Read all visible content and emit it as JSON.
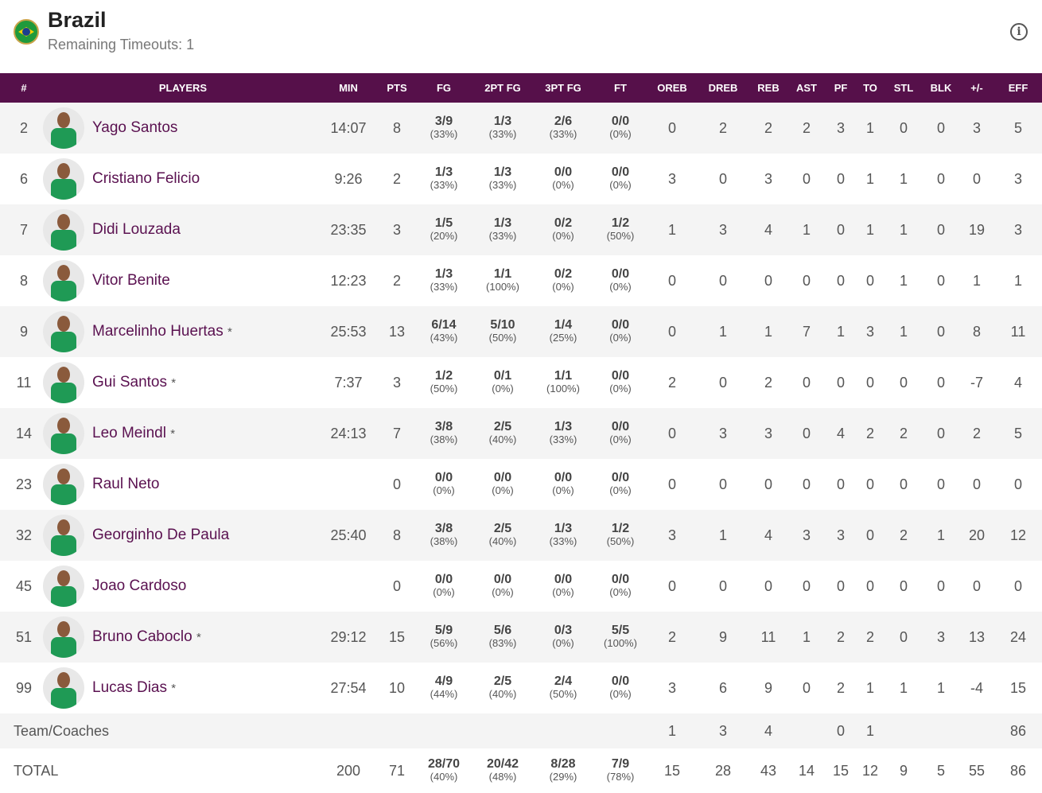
{
  "header": {
    "team": "Brazil",
    "timeouts": "Remaining Timeouts: 1",
    "flag_icon": "brazil-flag-icon",
    "info_icon": "info-icon"
  },
  "columns": [
    "#",
    "PLAYERS",
    "MIN",
    "PTS",
    "FG",
    "2PT FG",
    "3PT FG",
    "FT",
    "OREB",
    "DREB",
    "REB",
    "AST",
    "PF",
    "TO",
    "STL",
    "BLK",
    "+/-",
    "EFF"
  ],
  "players": [
    {
      "num": "2",
      "name": "Yago Santos",
      "star": "",
      "min": "14:07",
      "pts": "8",
      "fg": [
        "3/9",
        "(33%)"
      ],
      "p2": [
        "1/3",
        "(33%)"
      ],
      "p3": [
        "2/6",
        "(33%)"
      ],
      "ft": [
        "0/0",
        "(0%)"
      ],
      "s": [
        "0",
        "2",
        "2",
        "2",
        "3",
        "1",
        "0",
        "0",
        "3",
        "5"
      ]
    },
    {
      "num": "6",
      "name": "Cristiano Felicio",
      "star": "",
      "min": "9:26",
      "pts": "2",
      "fg": [
        "1/3",
        "(33%)"
      ],
      "p2": [
        "1/3",
        "(33%)"
      ],
      "p3": [
        "0/0",
        "(0%)"
      ],
      "ft": [
        "0/0",
        "(0%)"
      ],
      "s": [
        "3",
        "0",
        "3",
        "0",
        "0",
        "1",
        "1",
        "0",
        "0",
        "3"
      ]
    },
    {
      "num": "7",
      "name": "Didi Louzada",
      "star": "",
      "min": "23:35",
      "pts": "3",
      "fg": [
        "1/5",
        "(20%)"
      ],
      "p2": [
        "1/3",
        "(33%)"
      ],
      "p3": [
        "0/2",
        "(0%)"
      ],
      "ft": [
        "1/2",
        "(50%)"
      ],
      "s": [
        "1",
        "3",
        "4",
        "1",
        "0",
        "1",
        "1",
        "0",
        "19",
        "3"
      ]
    },
    {
      "num": "8",
      "name": "Vitor Benite",
      "star": "",
      "min": "12:23",
      "pts": "2",
      "fg": [
        "1/3",
        "(33%)"
      ],
      "p2": [
        "1/1",
        "(100%)"
      ],
      "p3": [
        "0/2",
        "(0%)"
      ],
      "ft": [
        "0/0",
        "(0%)"
      ],
      "s": [
        "0",
        "0",
        "0",
        "0",
        "0",
        "0",
        "1",
        "0",
        "1",
        "1"
      ]
    },
    {
      "num": "9",
      "name": "Marcelinho Huertas",
      "star": "*",
      "min": "25:53",
      "pts": "13",
      "fg": [
        "6/14",
        "(43%)"
      ],
      "p2": [
        "5/10",
        "(50%)"
      ],
      "p3": [
        "1/4",
        "(25%)"
      ],
      "ft": [
        "0/0",
        "(0%)"
      ],
      "s": [
        "0",
        "1",
        "1",
        "7",
        "1",
        "3",
        "1",
        "0",
        "8",
        "11"
      ]
    },
    {
      "num": "11",
      "name": "Gui Santos",
      "star": "*",
      "min": "7:37",
      "pts": "3",
      "fg": [
        "1/2",
        "(50%)"
      ],
      "p2": [
        "0/1",
        "(0%)"
      ],
      "p3": [
        "1/1",
        "(100%)"
      ],
      "ft": [
        "0/0",
        "(0%)"
      ],
      "s": [
        "2",
        "0",
        "2",
        "0",
        "0",
        "0",
        "0",
        "0",
        "-7",
        "4"
      ]
    },
    {
      "num": "14",
      "name": "Leo Meindl",
      "star": "*",
      "min": "24:13",
      "pts": "7",
      "fg": [
        "3/8",
        "(38%)"
      ],
      "p2": [
        "2/5",
        "(40%)"
      ],
      "p3": [
        "1/3",
        "(33%)"
      ],
      "ft": [
        "0/0",
        "(0%)"
      ],
      "s": [
        "0",
        "3",
        "3",
        "0",
        "4",
        "2",
        "2",
        "0",
        "2",
        "5"
      ]
    },
    {
      "num": "23",
      "name": "Raul Neto",
      "star": "",
      "min": "",
      "pts": "0",
      "fg": [
        "0/0",
        "(0%)"
      ],
      "p2": [
        "0/0",
        "(0%)"
      ],
      "p3": [
        "0/0",
        "(0%)"
      ],
      "ft": [
        "0/0",
        "(0%)"
      ],
      "s": [
        "0",
        "0",
        "0",
        "0",
        "0",
        "0",
        "0",
        "0",
        "0",
        "0"
      ]
    },
    {
      "num": "32",
      "name": "Georginho De Paula",
      "star": "",
      "min": "25:40",
      "pts": "8",
      "fg": [
        "3/8",
        "(38%)"
      ],
      "p2": [
        "2/5",
        "(40%)"
      ],
      "p3": [
        "1/3",
        "(33%)"
      ],
      "ft": [
        "1/2",
        "(50%)"
      ],
      "s": [
        "3",
        "1",
        "4",
        "3",
        "3",
        "0",
        "2",
        "1",
        "20",
        "12"
      ]
    },
    {
      "num": "45",
      "name": "Joao Cardoso",
      "star": "",
      "min": "",
      "pts": "0",
      "fg": [
        "0/0",
        "(0%)"
      ],
      "p2": [
        "0/0",
        "(0%)"
      ],
      "p3": [
        "0/0",
        "(0%)"
      ],
      "ft": [
        "0/0",
        "(0%)"
      ],
      "s": [
        "0",
        "0",
        "0",
        "0",
        "0",
        "0",
        "0",
        "0",
        "0",
        "0"
      ]
    },
    {
      "num": "51",
      "name": "Bruno Caboclo",
      "star": "*",
      "min": "29:12",
      "pts": "15",
      "fg": [
        "5/9",
        "(56%)"
      ],
      "p2": [
        "5/6",
        "(83%)"
      ],
      "p3": [
        "0/3",
        "(0%)"
      ],
      "ft": [
        "5/5",
        "(100%)"
      ],
      "s": [
        "2",
        "9",
        "11",
        "1",
        "2",
        "2",
        "0",
        "3",
        "13",
        "24"
      ]
    },
    {
      "num": "99",
      "name": "Lucas Dias",
      "star": "*",
      "min": "27:54",
      "pts": "10",
      "fg": [
        "4/9",
        "(44%)"
      ],
      "p2": [
        "2/5",
        "(40%)"
      ],
      "p3": [
        "2/4",
        "(50%)"
      ],
      "ft": [
        "0/0",
        "(0%)"
      ],
      "s": [
        "3",
        "6",
        "9",
        "0",
        "2",
        "1",
        "1",
        "1",
        "-4",
        "15"
      ]
    }
  ],
  "team_row": {
    "label": "Team/Coaches",
    "s": [
      "1",
      "3",
      "4",
      "",
      "0",
      "1",
      "",
      "",
      "",
      "86"
    ]
  },
  "total": {
    "label": "TOTAL",
    "min": "200",
    "pts": "71",
    "fg": [
      "28/70",
      "(40%)"
    ],
    "p2": [
      "20/42",
      "(48%)"
    ],
    "p3": [
      "8/28",
      "(29%)"
    ],
    "ft": [
      "7/9",
      "(78%)"
    ],
    "s": [
      "15",
      "28",
      "43",
      "14",
      "15",
      "12",
      "9",
      "5",
      "55",
      "86"
    ]
  }
}
